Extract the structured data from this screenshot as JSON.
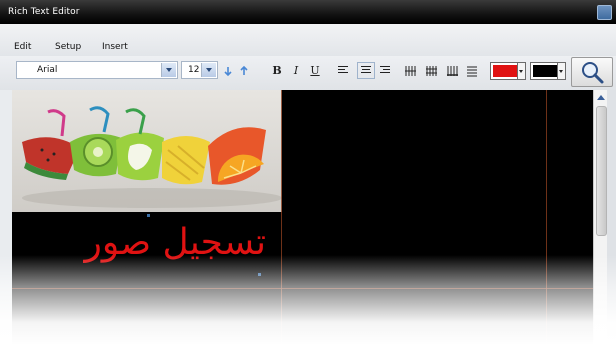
{
  "window": {
    "title": "Rich Text Editor"
  },
  "menu": {
    "edit": "Edit",
    "setup": "Setup",
    "insert": "Insert"
  },
  "toolbar": {
    "font_family": "Arial",
    "font_size": "12",
    "bold": "B",
    "italic": "I",
    "underline": "U",
    "text_color": "#e01212",
    "background_color": "#000000"
  },
  "editor": {
    "arabic_text": "تسجيل صور",
    "text_color": "#e01212",
    "background": "#000000"
  }
}
